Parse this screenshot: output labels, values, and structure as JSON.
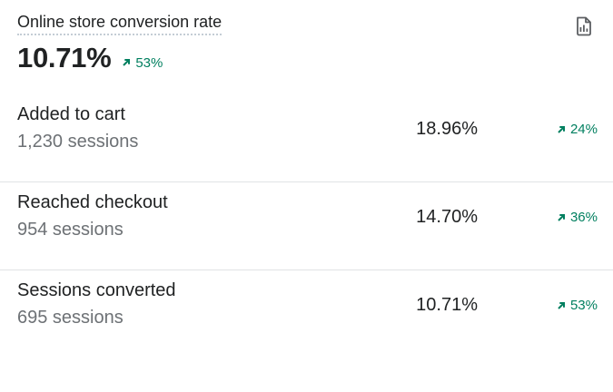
{
  "card": {
    "title": "Online store conversion rate",
    "value": "10.71%",
    "change": "53%",
    "report_icon": "view-report-icon"
  },
  "funnel": [
    {
      "label": "Added to cart",
      "sessions": "1,230 sessions",
      "rate": "18.96%",
      "change": "24%"
    },
    {
      "label": "Reached checkout",
      "sessions": "954 sessions",
      "rate": "14.70%",
      "change": "36%"
    },
    {
      "label": "Sessions converted",
      "sessions": "695 sessions",
      "rate": "10.71%",
      "change": "53%"
    }
  ],
  "colors": {
    "positive_trend": "#007f5f",
    "text": "#202223",
    "subdued_text": "#6d7175",
    "divider": "#e1e3e5"
  }
}
